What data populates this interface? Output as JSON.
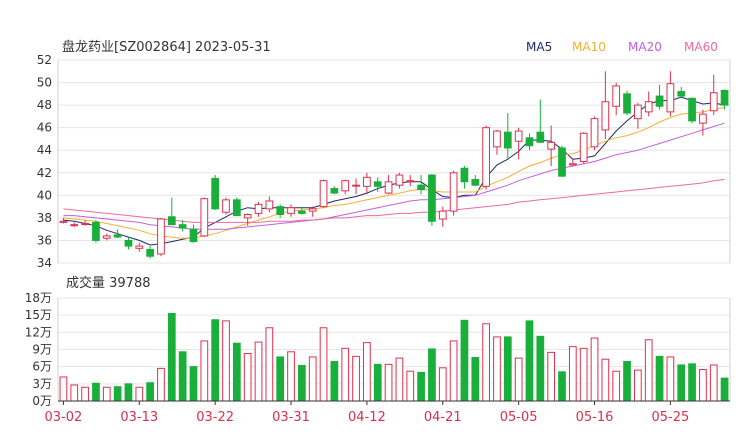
{
  "chart_data": [
    {
      "type": "candlestick",
      "title": "盘龙药业[SZ002864] 2023-05-31",
      "ylim": [
        34,
        52
      ],
      "yticks": [
        34,
        36,
        38,
        40,
        42,
        44,
        46,
        48,
        50,
        52
      ],
      "grid": true,
      "legend_position": "top-right",
      "legend": [
        {
          "name": "MA5",
          "color": "#1f2a6b"
        },
        {
          "name": "MA10",
          "color": "#f2b233"
        },
        {
          "name": "MA20",
          "color": "#c060e0"
        },
        {
          "name": "MA60",
          "color": "#f06a9a"
        }
      ],
      "up_color": "#e0314d",
      "down_color": "#1aaf3b",
      "ohlc": [
        [
          37.6,
          38.0,
          37.5,
          37.7
        ],
        [
          37.4,
          37.6,
          37.2,
          37.4
        ],
        [
          37.5,
          37.8,
          37.3,
          37.5
        ],
        [
          37.6,
          37.8,
          35.8,
          36.0
        ],
        [
          36.2,
          36.6,
          36.0,
          36.4
        ],
        [
          36.5,
          37.0,
          36.2,
          36.3
        ],
        [
          36.0,
          36.3,
          35.2,
          35.5
        ],
        [
          35.3,
          35.8,
          35.0,
          35.5
        ],
        [
          35.2,
          35.5,
          34.4,
          34.6
        ],
        [
          34.8,
          38.0,
          34.6,
          37.9
        ],
        [
          38.1,
          39.8,
          37.8,
          37.4
        ],
        [
          37.4,
          37.8,
          36.8,
          37.1
        ],
        [
          37.0,
          37.4,
          35.8,
          35.9
        ],
        [
          36.4,
          39.8,
          36.3,
          39.7
        ],
        [
          41.5,
          41.8,
          38.7,
          38.8
        ],
        [
          38.5,
          39.8,
          38.3,
          39.6
        ],
        [
          39.6,
          39.8,
          38.2,
          38.2
        ],
        [
          38.0,
          38.4,
          37.3,
          38.3
        ],
        [
          38.4,
          39.4,
          38.1,
          39.2
        ],
        [
          38.8,
          39.9,
          38.5,
          39.5
        ],
        [
          39.0,
          39.2,
          38.0,
          38.3
        ],
        [
          38.4,
          39.2,
          38.1,
          38.9
        ],
        [
          38.6,
          39.0,
          38.3,
          38.4
        ],
        [
          38.6,
          39.0,
          38.1,
          38.8
        ],
        [
          39.0,
          41.4,
          38.9,
          41.3
        ],
        [
          40.6,
          40.8,
          40.1,
          40.2
        ],
        [
          40.4,
          41.4,
          40.1,
          41.3
        ],
        [
          40.9,
          41.5,
          40.1,
          40.9
        ],
        [
          40.8,
          42.0,
          40.1,
          41.6
        ],
        [
          41.2,
          41.6,
          40.3,
          40.8
        ],
        [
          40.2,
          41.8,
          40.1,
          41.2
        ],
        [
          40.9,
          42.0,
          40.6,
          41.8
        ],
        [
          41.3,
          41.8,
          40.8,
          41.3
        ],
        [
          40.9,
          41.8,
          40.1,
          40.5
        ],
        [
          41.8,
          41.9,
          37.3,
          37.7
        ],
        [
          37.9,
          39.0,
          37.2,
          38.6
        ],
        [
          38.6,
          42.2,
          38.2,
          42.0
        ],
        [
          42.4,
          42.6,
          40.6,
          41.2
        ],
        [
          41.4,
          41.8,
          40.8,
          40.9
        ],
        [
          40.8,
          46.2,
          40.5,
          46.0
        ],
        [
          44.3,
          45.8,
          43.6,
          45.7
        ],
        [
          45.6,
          47.3,
          43.2,
          44.2
        ],
        [
          44.8,
          46.0,
          43.2,
          45.7
        ],
        [
          45.1,
          45.5,
          44.0,
          44.4
        ],
        [
          45.6,
          48.5,
          44.7,
          44.7
        ],
        [
          44.1,
          46.2,
          42.6,
          44.7
        ],
        [
          44.2,
          44.4,
          41.6,
          41.7
        ],
        [
          42.7,
          43.3,
          42.6,
          42.8
        ],
        [
          43.0,
          45.6,
          42.8,
          45.5
        ],
        [
          44.3,
          47.0,
          44.0,
          46.8
        ],
        [
          45.8,
          51.0,
          45.0,
          48.3
        ],
        [
          47.9,
          50.0,
          47.1,
          49.7
        ],
        [
          49.0,
          49.3,
          47.1,
          47.3
        ],
        [
          46.8,
          48.2,
          45.9,
          48.0
        ],
        [
          47.4,
          49.2,
          47.0,
          48.3
        ],
        [
          48.8,
          49.8,
          47.6,
          47.9
        ],
        [
          47.4,
          51.0,
          47.0,
          49.9
        ],
        [
          49.2,
          49.6,
          48.6,
          48.8
        ],
        [
          48.6,
          48.7,
          46.4,
          46.6
        ],
        [
          46.4,
          47.6,
          45.3,
          47.2
        ],
        [
          47.5,
          50.7,
          47.1,
          49.1
        ],
        [
          49.3,
          49.4,
          47.6,
          48.0
        ]
      ],
      "ma": {
        "MA5": [
          37.8,
          37.7,
          37.5,
          37.3,
          36.9,
          36.6,
          36.3,
          36.0,
          35.6,
          35.7,
          35.9,
          36.1,
          36.3,
          37.1,
          37.6,
          38.1,
          38.6,
          38.9,
          38.8,
          38.9,
          38.9,
          38.9,
          38.9,
          38.9,
          39.2,
          39.5,
          39.7,
          39.9,
          40.2,
          40.6,
          40.9,
          41.1,
          41.2,
          41.2,
          40.5,
          39.9,
          39.8,
          40.0,
          40.0,
          41.6,
          42.7,
          43.2,
          43.9,
          44.9,
          44.9,
          44.8,
          44.1,
          43.2,
          43.3,
          43.5,
          44.6,
          45.7,
          46.6,
          47.4,
          48.1,
          48.4,
          48.4,
          48.7,
          48.4,
          48.1,
          48.2,
          48.0
        ],
        "MA10": [
          38.0,
          37.9,
          37.8,
          37.7,
          37.5,
          37.3,
          37.1,
          36.9,
          36.6,
          36.4,
          36.3,
          36.2,
          36.2,
          36.4,
          36.6,
          36.9,
          37.2,
          37.5,
          37.8,
          38.1,
          38.4,
          38.6,
          38.7,
          38.8,
          38.9,
          39.1,
          39.2,
          39.4,
          39.6,
          39.8,
          40.0,
          40.2,
          40.4,
          40.6,
          40.4,
          40.3,
          40.3,
          40.3,
          40.3,
          40.8,
          41.2,
          41.6,
          42.1,
          42.6,
          42.9,
          43.3,
          43.6,
          43.7,
          44.0,
          44.4,
          44.8,
          45.1,
          45.3,
          45.6,
          46.0,
          46.5,
          46.9,
          47.2,
          47.3,
          47.4,
          47.6,
          47.8
        ],
        "MA20": [
          38.2,
          38.2,
          38.1,
          38.0,
          37.9,
          37.8,
          37.7,
          37.6,
          37.4,
          37.3,
          37.2,
          37.1,
          37.0,
          37.0,
          37.0,
          37.0,
          37.1,
          37.2,
          37.3,
          37.4,
          37.5,
          37.6,
          37.7,
          37.8,
          37.9,
          38.1,
          38.3,
          38.5,
          38.7,
          38.9,
          39.1,
          39.3,
          39.5,
          39.6,
          39.6,
          39.7,
          39.8,
          39.9,
          40.0,
          40.3,
          40.6,
          40.9,
          41.3,
          41.6,
          41.9,
          42.2,
          42.4,
          42.6,
          42.8,
          43.0,
          43.3,
          43.6,
          43.8,
          44.0,
          44.3,
          44.6,
          44.9,
          45.2,
          45.5,
          45.8,
          46.1,
          46.4
        ],
        "MA60": [
          38.8,
          38.7,
          38.6,
          38.5,
          38.4,
          38.3,
          38.2,
          38.1,
          38.0,
          37.9,
          37.8,
          37.7,
          37.6,
          37.6,
          37.6,
          37.6,
          37.6,
          37.6,
          37.6,
          37.7,
          37.7,
          37.7,
          37.8,
          37.8,
          37.9,
          38.0,
          38.0,
          38.1,
          38.2,
          38.2,
          38.3,
          38.4,
          38.4,
          38.5,
          38.5,
          38.6,
          38.7,
          38.8,
          38.9,
          39.0,
          39.1,
          39.2,
          39.4,
          39.5,
          39.6,
          39.7,
          39.8,
          39.9,
          40.0,
          40.1,
          40.2,
          40.3,
          40.4,
          40.5,
          40.6,
          40.7,
          40.8,
          40.9,
          41.0,
          41.1,
          41.3,
          41.4
        ]
      }
    },
    {
      "type": "bar",
      "title": "成交量 39788",
      "ylim": [
        0,
        18
      ],
      "yticks": [
        "0万",
        "3万",
        "6万",
        "9万",
        "12万",
        "15万",
        "18万"
      ],
      "ytick_values": [
        0,
        3,
        6,
        9,
        12,
        15,
        18
      ],
      "x_tick_labels": [
        "03-02",
        "03-13",
        "03-22",
        "03-31",
        "04-12",
        "04-21",
        "05-05",
        "05-16",
        "05-25"
      ],
      "x_tick_index": [
        0,
        7,
        14,
        21,
        28,
        35,
        42,
        49,
        56
      ],
      "values_wan": [
        4.2,
        2.8,
        2.4,
        3.1,
        2.4,
        2.5,
        3.0,
        2.4,
        3.2,
        5.7,
        15.3,
        8.6,
        6.0,
        10.5,
        14.2,
        14.0,
        10.1,
        8.3,
        10.3,
        12.8,
        7.7,
        8.6,
        6.2,
        7.7,
        12.8,
        6.9,
        9.2,
        7.8,
        10.2,
        6.4,
        6.4,
        7.5,
        5.2,
        5.0,
        9.1,
        5.8,
        10.5,
        14.1,
        7.6,
        13.5,
        11.2,
        11.2,
        7.5,
        14.0,
        11.3,
        8.5,
        5.1,
        9.5,
        9.2,
        11.0,
        7.3,
        5.2,
        6.9,
        5.4,
        10.7,
        7.8,
        7.7,
        6.3,
        6.5,
        5.5,
        6.3,
        4.0
      ]
    }
  ]
}
